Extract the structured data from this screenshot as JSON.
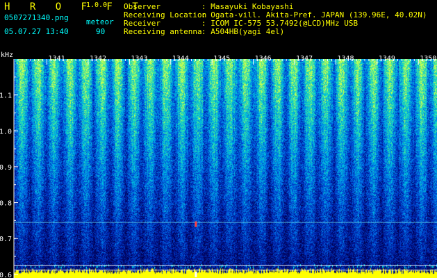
{
  "app": {
    "title": "H R O F F T",
    "version": "1.0.0"
  },
  "file": {
    "name": "0507271340.png",
    "datetime": "05.07.27 13:40"
  },
  "meteor": {
    "label": "meteor",
    "count": "90"
  },
  "meta": [
    {
      "key": "Observer",
      "value": ": Masayuki Kobayashi"
    },
    {
      "key": "Receiving Location",
      "value": ": Ogata-vill. Akita-Pref. JAPAN (139.96E, 40.02N)"
    },
    {
      "key": "Receiver",
      "value": ": ICOM IC-575 53.7492(@LCD)MHz USB"
    },
    {
      "key": "Receiving antenna",
      "value": ": A504HB(yagi 4el)"
    }
  ],
  "colors": {
    "header_yellow": "#ffff00",
    "header_cyan": "#00ffff",
    "axis_white": "#ffffff",
    "background": "#000000"
  },
  "chart_data": {
    "type": "heatmap",
    "ylabel": "kHz",
    "yticks": [
      "1.1",
      "1.0",
      "0.9",
      "0.8",
      "0.7",
      "0.6"
    ],
    "ylim": [
      0.59,
      1.2
    ],
    "xticks": [
      "1341",
      "1342",
      "1343",
      "1344",
      "1345",
      "1346",
      "1347",
      "1348",
      "1349",
      "1350"
    ],
    "xlim_minutes": [
      1340.2,
      1350.45
    ],
    "reference_lines_khz": [
      0.745,
      0.625,
      0.612
    ],
    "meteor_marks": [
      {
        "time": 1344.6,
        "freq_khz": 0.74
      },
      {
        "time": 1344.6,
        "freq_khz": 0.6
      }
    ]
  }
}
